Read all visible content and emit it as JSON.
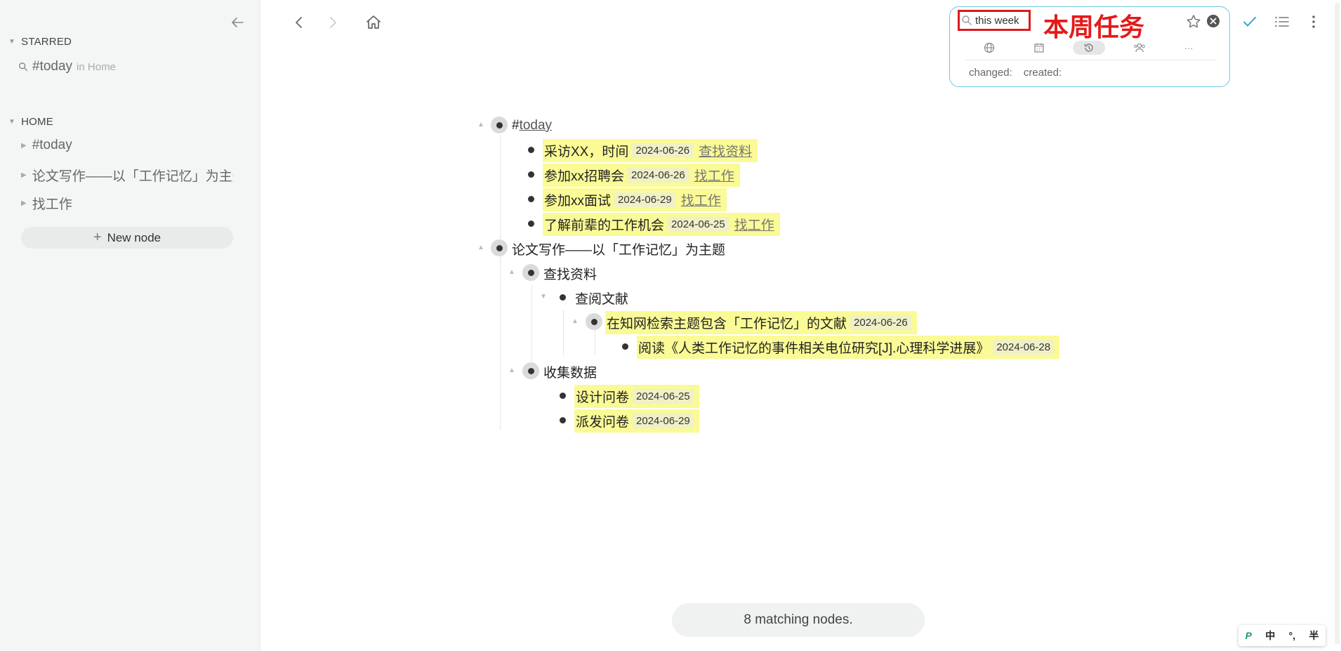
{
  "sidebar": {
    "starred": {
      "title": "STARRED",
      "items": [
        {
          "label": "#today",
          "context": "in Home"
        }
      ]
    },
    "home": {
      "title": "HOME",
      "items": [
        {
          "label": "#today"
        },
        {
          "label": "论文写作——以「工作记忆」为主题"
        },
        {
          "label": "找工作"
        }
      ]
    },
    "new_node_label": "New node"
  },
  "search": {
    "value": "this week",
    "annotation": "本周任务",
    "filters": [
      "globe-icon",
      "calendar-icon",
      "history-icon",
      "people-icon",
      "more-icon"
    ],
    "active_filter": "history-icon",
    "meta": {
      "changed_label": "changed:",
      "created_label": "created:"
    }
  },
  "outline": {
    "today": {
      "prefix": "#",
      "label": "today",
      "children": [
        {
          "text": "采访XX，时间",
          "date": "2024-06-26",
          "link": "查找资料"
        },
        {
          "text": "参加xx招聘会",
          "date": "2024-06-26",
          "link": "找工作"
        },
        {
          "text": "参加xx面试",
          "date": "2024-06-29",
          "link": "找工作"
        },
        {
          "text": "了解前辈的工作机会",
          "date": "2024-06-25",
          "link": "找工作"
        }
      ]
    },
    "paper": {
      "label": "论文写作——以「工作记忆」为主题",
      "search_materials": {
        "label": "查找资料",
        "read_lit": {
          "label": "查阅文献",
          "cnki": {
            "text": "在知网检索主题包含「工作记忆」的文献",
            "date": "2024-06-26"
          },
          "read": {
            "text": "阅读《人类工作记忆的事件相关电位研究[J].心理科学进展》",
            "date": "2024-06-28"
          }
        }
      },
      "collect_data": {
        "label": "收集数据",
        "items": [
          {
            "text": "设计问卷",
            "date": "2024-06-25"
          },
          {
            "text": "派发问卷",
            "date": "2024-06-29"
          }
        ]
      }
    }
  },
  "status": "8 matching nodes.",
  "ime": {
    "logo": "P",
    "mode": "中",
    "punct": "°,",
    "width": "半"
  }
}
